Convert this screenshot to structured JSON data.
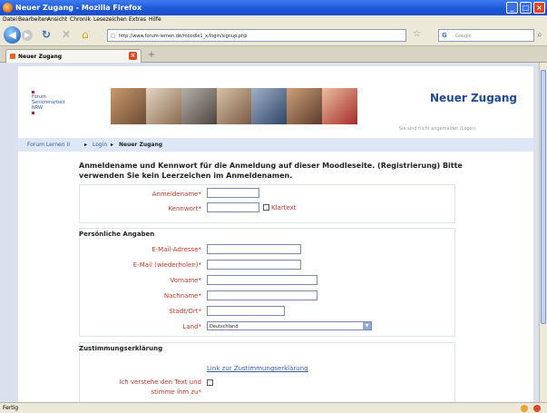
{
  "window": {
    "title": "Neuer Zugang - Mozilla Firefox"
  },
  "menu": [
    "Datei",
    "Bearbeiten",
    "Ansicht",
    "Chronik",
    "Lesezeichen",
    "Extras",
    "Hilfe"
  ],
  "nav": {
    "url": "http://www.forum-lernen.de/moodle1_x/login/signup.php",
    "search_placeholder": "Google",
    "back_icon": "back-arrow-icon",
    "reload_icon": "reload-icon",
    "stop_icon": "stop-icon",
    "home_icon": "home-icon"
  },
  "tab": {
    "label": "Neuer Zugang"
  },
  "page": {
    "logo_text": [
      "Forum",
      "Seniorenarbeit",
      "NRW"
    ],
    "site_title": "Neuer Zugang",
    "login_info": "Sie sind nicht angemeldet (Login)",
    "breadcrumb": {
      "home": "Forum Lernen II",
      "login": "Login",
      "current": "Neuer Zugang",
      "separator": "▸"
    },
    "intro": "Anmeldename und Kennwort für die Anmeldung auf dieser Moodleseite. (Registrierung) Bitte verwenden Sie kein Leerzeichen im Anmeldenamen.",
    "account": {
      "username_label": "Anmeldename*",
      "password_label": "Kennwort*",
      "cleartext_label": "Klartext"
    },
    "personal": {
      "heading": "Persönliche Angaben",
      "email_label": "E-Mail-Adresse*",
      "email_repeat_label": "E-Mail (wiederholen)*",
      "firstname_label": "Vorname*",
      "lastname_label": "Nachname*",
      "city_label": "Stadt/Ort*",
      "country_label": "Land*",
      "country_value": "Deutschland"
    },
    "agreement": {
      "heading": "Zustimmungserklärung",
      "link": "Link zur Zustimmungserklärung",
      "consent_line1": "Ich verstehe den Text und",
      "consent_line2": "stimme ihm zu*"
    }
  },
  "status": {
    "text": "Fertig"
  },
  "colors": {
    "accent": "#1f4a9a",
    "required_label": "#c0392b",
    "breadcrumb_bg": "#dde7f5"
  }
}
